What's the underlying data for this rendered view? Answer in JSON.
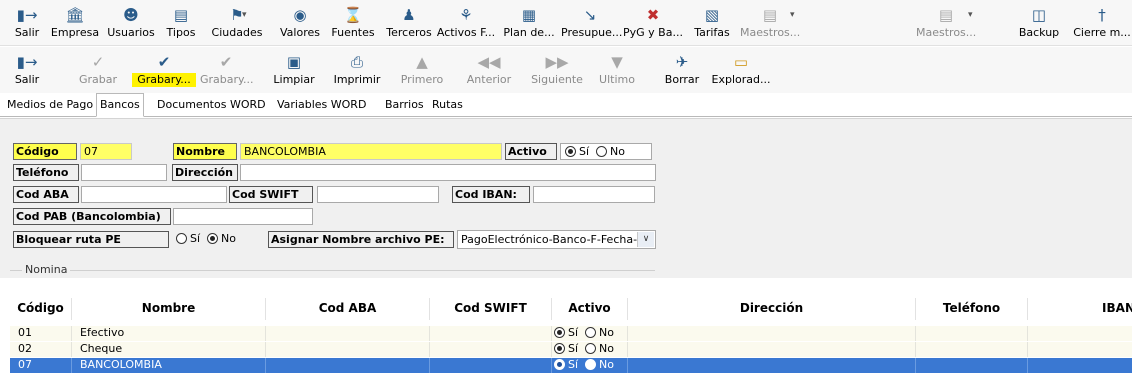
{
  "toolbar1": [
    {
      "icon": "exit-door",
      "label": "Salir",
      "style": "sel"
    },
    {
      "icon": "building",
      "label": "Empresa",
      "style": ""
    },
    {
      "icon": "users",
      "label": "Usuarios",
      "style": ""
    },
    {
      "icon": "types",
      "label": "Tipos",
      "style": ""
    },
    {
      "icon": "cities",
      "label": "Ciudades",
      "style": "dd"
    },
    {
      "icon": "money-bag",
      "label": "Valores",
      "style": ""
    },
    {
      "icon": "sources",
      "label": "Fuentes",
      "style": ""
    },
    {
      "icon": "third-parties",
      "label": "Terceros",
      "style": ""
    },
    {
      "icon": "fixed-assets",
      "label": "Activos F...",
      "style": ""
    },
    {
      "icon": "chart-of-accounts",
      "label": "Plan de...",
      "style": ""
    },
    {
      "icon": "budget-chart",
      "label": "Presupue...",
      "style": ""
    },
    {
      "icon": "pyg-chart",
      "label": "PyG y Ba...",
      "style": ""
    },
    {
      "icon": "rates",
      "label": "Tarifas",
      "style": ""
    },
    {
      "icon": "masters",
      "label": "Maestros...",
      "style": "dim"
    },
    {
      "icon": "masters-2",
      "label": "Maestros...",
      "style": "dim dd"
    },
    {
      "icon": "backup",
      "label": "Backup",
      "style": ""
    },
    {
      "icon": "close-month",
      "label": "Cierre m...",
      "style": ""
    }
  ],
  "toolbar2": [
    {
      "icon": "exit-door",
      "label": "Salir",
      "style": ""
    },
    {
      "icon": "save",
      "label": "Grabar",
      "style": "dim"
    },
    {
      "icon": "save-and",
      "label": "Grabary...",
      "style": "hl"
    },
    {
      "icon": "save-and-2",
      "label": "Grabary...",
      "style": "dim"
    },
    {
      "icon": "clear",
      "label": "Limpiar",
      "style": ""
    },
    {
      "icon": "print",
      "label": "Imprimir",
      "style": ""
    },
    {
      "icon": "first",
      "label": "Primero",
      "style": "dim"
    },
    {
      "icon": "previous",
      "label": "Anterior",
      "style": "dim"
    },
    {
      "icon": "next",
      "label": "Siguiente",
      "style": "dim"
    },
    {
      "icon": "last",
      "label": "Ultimo",
      "style": "dim"
    },
    {
      "icon": "eraser",
      "label": "Borrar",
      "style": ""
    },
    {
      "icon": "folder",
      "label": "Explorad...",
      "style": ""
    }
  ],
  "tabs": [
    "Medios de Pago",
    "Bancos",
    "Documentos WORD",
    "Variables WORD",
    "Barrios",
    "Rutas"
  ],
  "active_tab": "Bancos",
  "form": {
    "codigo_label": "Código",
    "codigo_value": "07",
    "nombre_label": "Nombre",
    "nombre_value": "BANCOLOMBIA",
    "activo_label": "Activo",
    "activo_yes": "Sí",
    "activo_no": "No",
    "telefono_label": "Teléfono",
    "telefono_value": "",
    "direccion_label": "Dirección",
    "direccion_value": "",
    "codaba_label": "Cod ABA",
    "codaba_value": "",
    "codswift_label": "Cod SWIFT",
    "codswift_value": "",
    "codiban_label": "Cod IBAN:",
    "codiban_value": "",
    "codpab_label": "Cod PAB (Bancolombia)",
    "codpab_value": "",
    "bloquear_label": "Bloquear ruta PE",
    "bloquear_yes": "Sí",
    "bloquear_no": "No",
    "asignar_label": "Asignar Nombre archivo PE:",
    "asignar_value": "PagoElectrónico-Banco-F-Fecha-",
    "nomina_label": "Nomina"
  },
  "grid": {
    "columns": [
      "Código",
      "Nombre",
      "Cod ABA",
      "Cod SWIFT",
      "Activo",
      "Dirección",
      "Teléfono",
      "IBAN"
    ],
    "rows": [
      {
        "codigo": "01",
        "nombre": "Efectivo",
        "activo_yes": "Sí",
        "activo_no": "No",
        "selected": false
      },
      {
        "codigo": "02",
        "nombre": "Cheque",
        "activo_yes": "Sí",
        "activo_no": "No",
        "selected": false
      },
      {
        "codigo": "07",
        "nombre": "BANCOLOMBIA",
        "activo_yes": "Sí",
        "activo_no": "No",
        "selected": true
      }
    ]
  },
  "colors": {
    "highlight": "#ffff4d",
    "selection": "#3a78d2",
    "panel": "#f0f0f0",
    "icon": "#2b5c8a"
  }
}
